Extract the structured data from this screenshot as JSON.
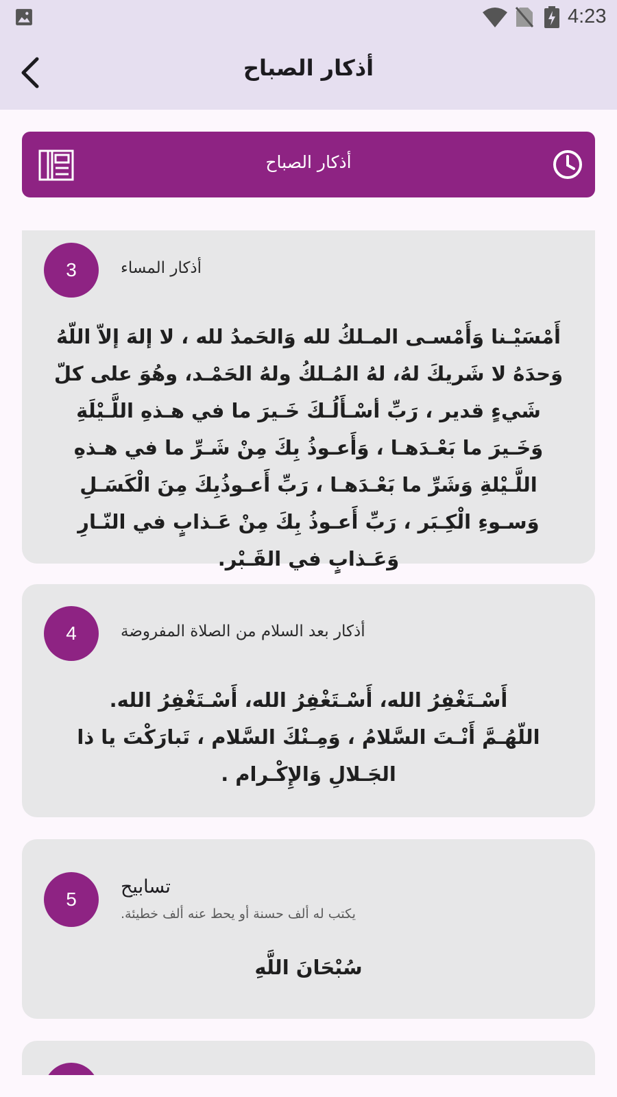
{
  "status_bar": {
    "time": "4:23",
    "icons": [
      "gallery-icon",
      "wifi-icon",
      "no-sim-icon",
      "battery-charging-icon"
    ]
  },
  "app_bar": {
    "title": "أذكار الصباح",
    "back_icon": "chevron-left-icon"
  },
  "banner": {
    "title": "أذكار الصباح",
    "left_icon": "book-icon",
    "right_icon": "clock-icon",
    "color": "#8e2383"
  },
  "cards": [
    {
      "number": "3",
      "title": "أذكار المساء",
      "text": "أَمْسَيْـنا وَأَمْسـى المـلكُ لله وَالحَمدُ لله ، لا إلهَ إلاّ اللّهُ وَحدَهُ لا شَريكَ لهُ، لهُ المُـلكُ ولهُ الحَمْـد، وهُوَ على كلّ شَيءٍ قدير ، رَبِّ أسْـأَلُـكَ خَـيرَ ما في هـذهِ اللَّـيْلَةِ وَخَـيرَ ما بَعْـدَهـا ، وَأَعـوذُ بِكَ مِنْ شَـرِّ ما في هـذهِ اللَّـيْلةِ وَشَرِّ ما بَعْـدَهـا ، رَبِّ أَعـوذُبِكَ مِنَ الْكَسَـلِ وَسـوءِ الْكِـبَر ، رَبِّ أَعـوذُ بِكَ مِنْ عَـذابٍ في النّـارِ وَعَـذابٍ في القَـبْر."
    },
    {
      "number": "4",
      "title": "أذكار بعد السلام من الصلاة المفروضة",
      "text": "أَسْـتَغْفِرُ الله، أَسْـتَغْفِرُ الله، أَسْـتَغْفِرُ الله.\nاللّهُـمَّ أَنْـتَ السَّلامُ ، وَمِـنْكَ السَّلام ، تَبارَكْتَ يا ذا الجَـلالِ وَالإِكْـرام ."
    },
    {
      "number": "5",
      "title": "تسابيح",
      "subtitle": "يكتب له ألف حسنة أو يحط عنه ألف خطيئة.",
      "text": "سُبْحَانَ اللَّهِ"
    }
  ],
  "colors": {
    "accent": "#8e2383",
    "app_bar_bg": "#e6dff0",
    "card_bg": "#e7e7e8",
    "page_bg": "#fdf7fd"
  }
}
